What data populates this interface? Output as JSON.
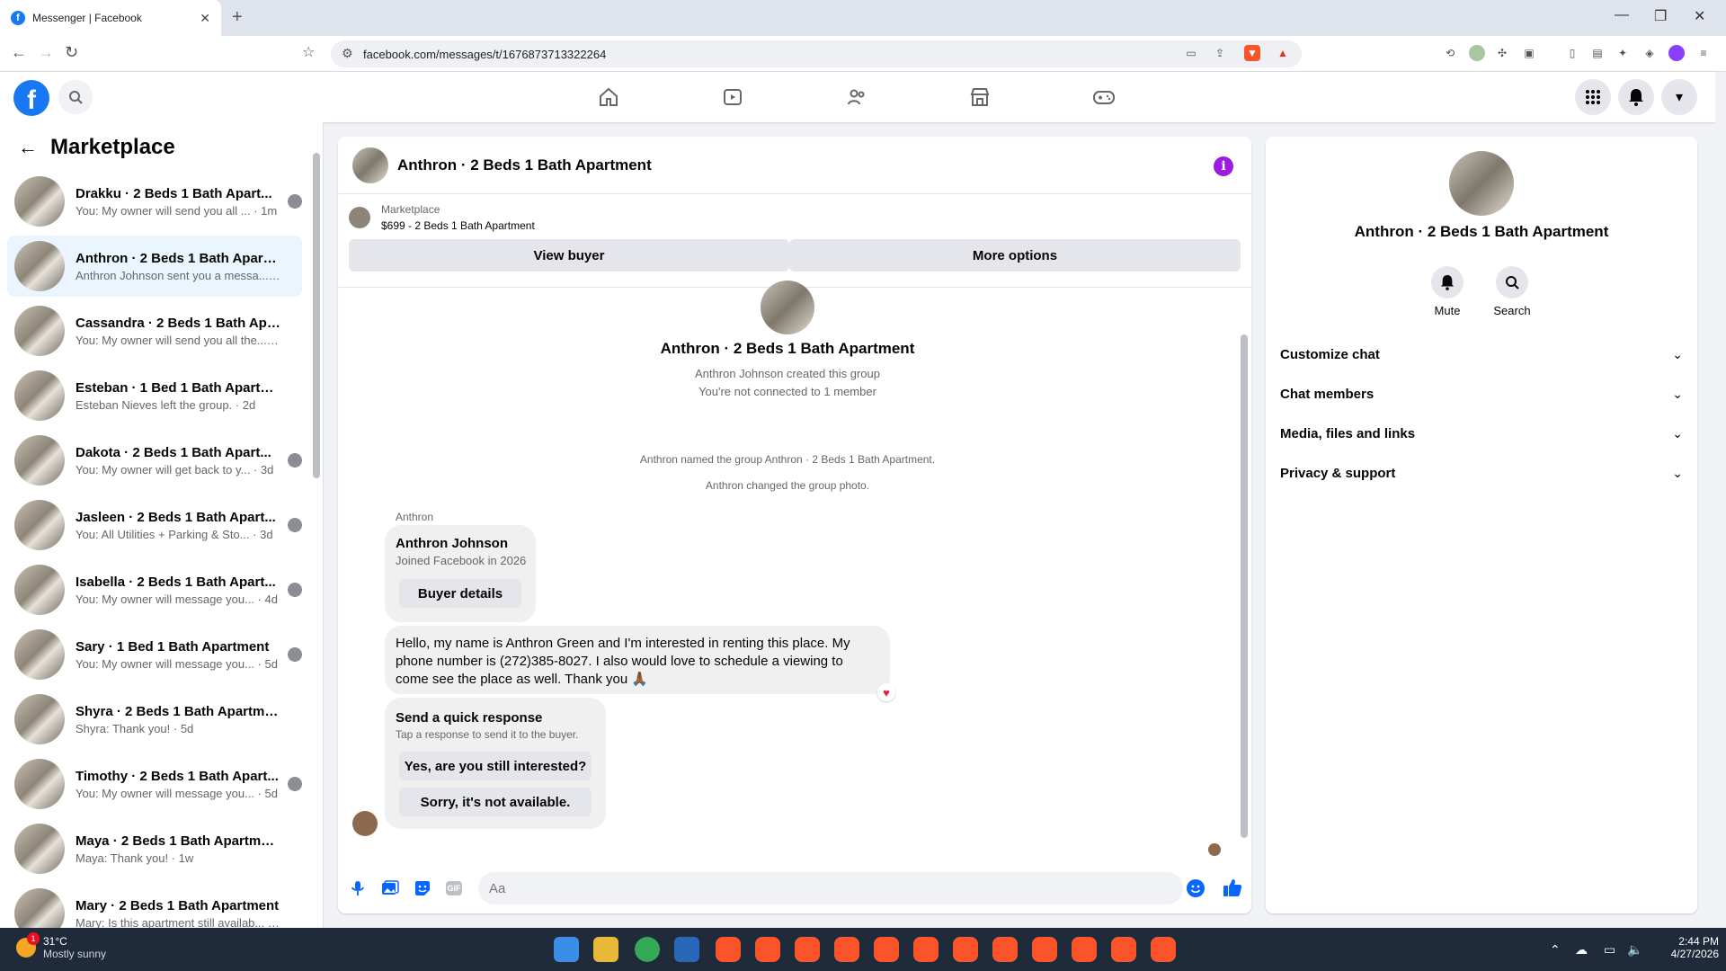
{
  "browser": {
    "tab_title": "Messenger | Facebook",
    "url": "facebook.com/messages/t/1676873713322264"
  },
  "left": {
    "title": "Marketplace",
    "conversations": [
      {
        "name": "Drakku · 2 Beds 1 Bath Apart...",
        "snippet": "You: My owner will send you all ... · 1m"
      },
      {
        "name": "Anthron · 2 Beds 1 Bath Apartm...",
        "snippet": "Anthron Johnson sent you a messa... · 1h"
      },
      {
        "name": "Cassandra · 2 Beds 1 Bath Apart...",
        "snippet": "You: My owner will send you all the... · 2d"
      },
      {
        "name": "Esteban · 1 Bed 1 Bath Apartment",
        "snippet": "Esteban Nieves left the group. · 2d"
      },
      {
        "name": "Dakota · 2 Beds 1 Bath Apart...",
        "snippet": "You: My owner will get back to y... · 3d"
      },
      {
        "name": "Jasleen · 2 Beds 1 Bath Apart...",
        "snippet": "You: All Utilities + Parking & Sto... · 3d"
      },
      {
        "name": "Isabella · 2 Beds 1 Bath Apart...",
        "snippet": "You: My owner will message you... · 4d"
      },
      {
        "name": "Sary · 1 Bed 1 Bath Apartment",
        "snippet": "You: My owner will message you... · 5d"
      },
      {
        "name": "Shyra · 2 Beds 1 Bath Apartment",
        "snippet": "Shyra: Thank you! · 5d"
      },
      {
        "name": "Timothy · 2 Beds 1 Bath Apart...",
        "snippet": "You: My owner will message you... · 5d"
      },
      {
        "name": "Maya · 2 Beds 1 Bath Apartment",
        "snippet": "Maya: Thank you! · 1w"
      },
      {
        "name": "Mary · 2 Beds 1 Bath Apartment",
        "snippet": "Mary: Is this apartment still availab... · 1w"
      }
    ]
  },
  "chat": {
    "title": "Anthron · 2 Beds 1 Bath Apartment",
    "marketplace_label": "Marketplace",
    "listing": "$699 - 2 Beds 1 Bath Apartment",
    "view_buyer": "View buyer",
    "more_options": "More options",
    "group_name": "Anthron · 2 Beds 1 Bath Apartment",
    "created": "Anthron Johnson created this group",
    "not_connected": "You're not connected to 1 member",
    "named_event": "Anthron named the group Anthron · 2 Beds 1 Bath Apartment.",
    "photo_event": "Anthron changed the group photo.",
    "sender": "Anthron",
    "buyer_name": "Anthron Johnson",
    "buyer_joined": "Joined Facebook in 2026",
    "buyer_details": "Buyer details",
    "message": "Hello, my name is Anthron Green and I'm interested in renting this place. My phone number is (272)385-8027. I also would love to schedule a viewing to come see the place as well. Thank you 🙏🏾",
    "quick_title": "Send a quick response",
    "quick_sub": "Tap a response to send it to the buyer.",
    "quick_1": "Yes, are you still interested?",
    "quick_2": "Sorry, it's not available.",
    "composer_placeholder": "Aa"
  },
  "right": {
    "name": "Anthron · 2 Beds 1 Bath Apartment",
    "mute": "Mute",
    "search": "Search",
    "sections": [
      "Customize chat",
      "Chat members",
      "Media, files and links",
      "Privacy & support"
    ]
  },
  "taskbar": {
    "temp": "31°C",
    "weather": "Mostly sunny",
    "badge": "1",
    "time": "2:44 PM",
    "date": "4/27/2026"
  },
  "colors": {
    "facebook_blue": "#1877f2",
    "messenger_blue": "#0866ff",
    "info_purple": "#9a1ce0",
    "active_row": "#ebf5ff"
  }
}
